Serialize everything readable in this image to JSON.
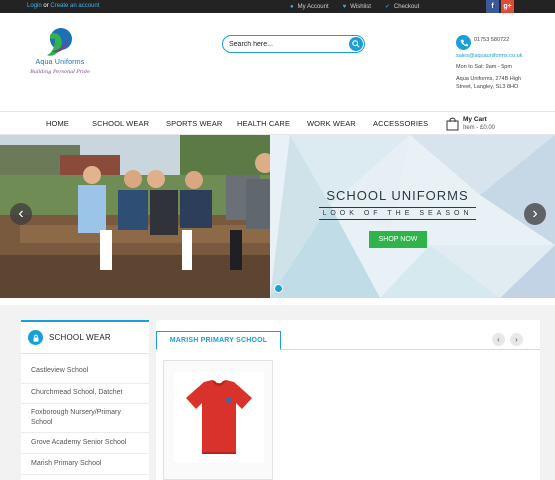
{
  "topbar": {
    "login": "Login",
    "or": " or ",
    "create_account": "Create an account",
    "links": [
      "My Account",
      "Wishlist",
      "Checkout"
    ],
    "social": [
      "f",
      "g+"
    ]
  },
  "brand": {
    "name": "Aqua Uniforms",
    "tagline": "Building Personal Pride"
  },
  "search": {
    "placeholder": "Search here..."
  },
  "contact": {
    "phone": "01753 580722",
    "email": "sales@aquauniforms.co.uk",
    "hours": "Mon to Sat: 9am - 5pm",
    "address_line1": "Aqua Uniforms, 274B High",
    "address_line2": "Street, Langley, SL3 8HO"
  },
  "nav": {
    "items": [
      "HOME",
      "SCHOOL WEAR",
      "SPORTS WEAR",
      "HEALTH CARE",
      "WORK WEAR",
      "ACCESSORIES"
    ],
    "cart_title": "My Cart",
    "cart_sub": "Item - £0.00"
  },
  "banner": {
    "title": "SCHOOL UNIFORMS",
    "subtitle": "LOOK OF THE SEASON",
    "button": "SHOP NOW"
  },
  "sidebar": {
    "title": "SCHOOL WEAR",
    "items": [
      "Castleview School",
      "Churchmead School, Datchet",
      "Foxborough Nursery/Primary School",
      "Grove Academy Senior School",
      "Marish Primary School"
    ]
  },
  "products": {
    "tab": "MARISH PRIMARY SCHOOL"
  },
  "colors": {
    "accent": "#1b9fd8",
    "topbar": "#232323",
    "facebook": "#3b5998",
    "google": "#dd4b39",
    "button_green": "#2fb34a"
  }
}
